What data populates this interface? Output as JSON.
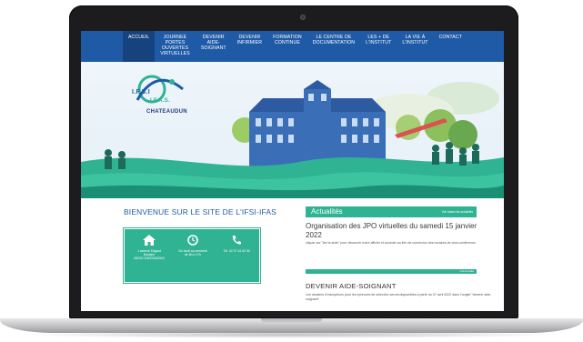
{
  "nav": {
    "items": [
      {
        "label": [
          "ACCUEIL"
        ]
      },
      {
        "label": [
          "JOURNEE",
          "PORTES",
          "OUVERTES",
          "VIRTUELLES"
        ]
      },
      {
        "label": [
          "DEVENIR",
          "AIDE-",
          "SOIGNANT"
        ]
      },
      {
        "label": [
          "DEVENIR",
          "INFIRMIER"
        ]
      },
      {
        "label": [
          "FORMATION",
          "CONTINUE"
        ]
      },
      {
        "label": [
          "LE CENTRE DE",
          "DOCUMENTATION"
        ]
      },
      {
        "label": [
          "LES + DE",
          "L'INSTITUT"
        ]
      },
      {
        "label": [
          "LA VIE À",
          "L'INSTITUT"
        ]
      },
      {
        "label": [
          "CONTACT"
        ]
      }
    ]
  },
  "logo": {
    "text_main": "I.F.S.I",
    "text_sub": "I.F.A.S.",
    "city": "CHATEAUDUN"
  },
  "welcome": "BIENVENUE SUR LE SITE DE L'IFSI-IFAS",
  "info": {
    "address": [
      "1 avenue Edgard",
      "Boulanc",
      "28200 CHATEAUDUN"
    ],
    "hours": [
      "Du lundi au vendredi",
      "de 8h à 17h"
    ],
    "phone": [
      "Tél. 02 37 44 62 93"
    ]
  },
  "news": {
    "header": "Actualités",
    "see_all": "Voir toutes les actualités",
    "article1_title": "Organisation des JPO virtuelles du samedi 15 janvier 2022",
    "article1_body": "cliquer sur \"lire la suite\" pour découvrir notre affiche et accéder au lien de connexion des horaires de visio-conférence.",
    "read_more": "Lire la suite",
    "article2_title": "DEVENIR AIDE-SOIGNANT",
    "article2_body": "Les dossiers d'inscriptions pour les épreuves de sélection seront disponibles à partir du 07 avril 2022 dans l'onglet \"devenir aide-soignant\"."
  },
  "colors": {
    "nav": "#1f5aa6",
    "accent": "#2fb393",
    "title": "#1f5aa6"
  }
}
